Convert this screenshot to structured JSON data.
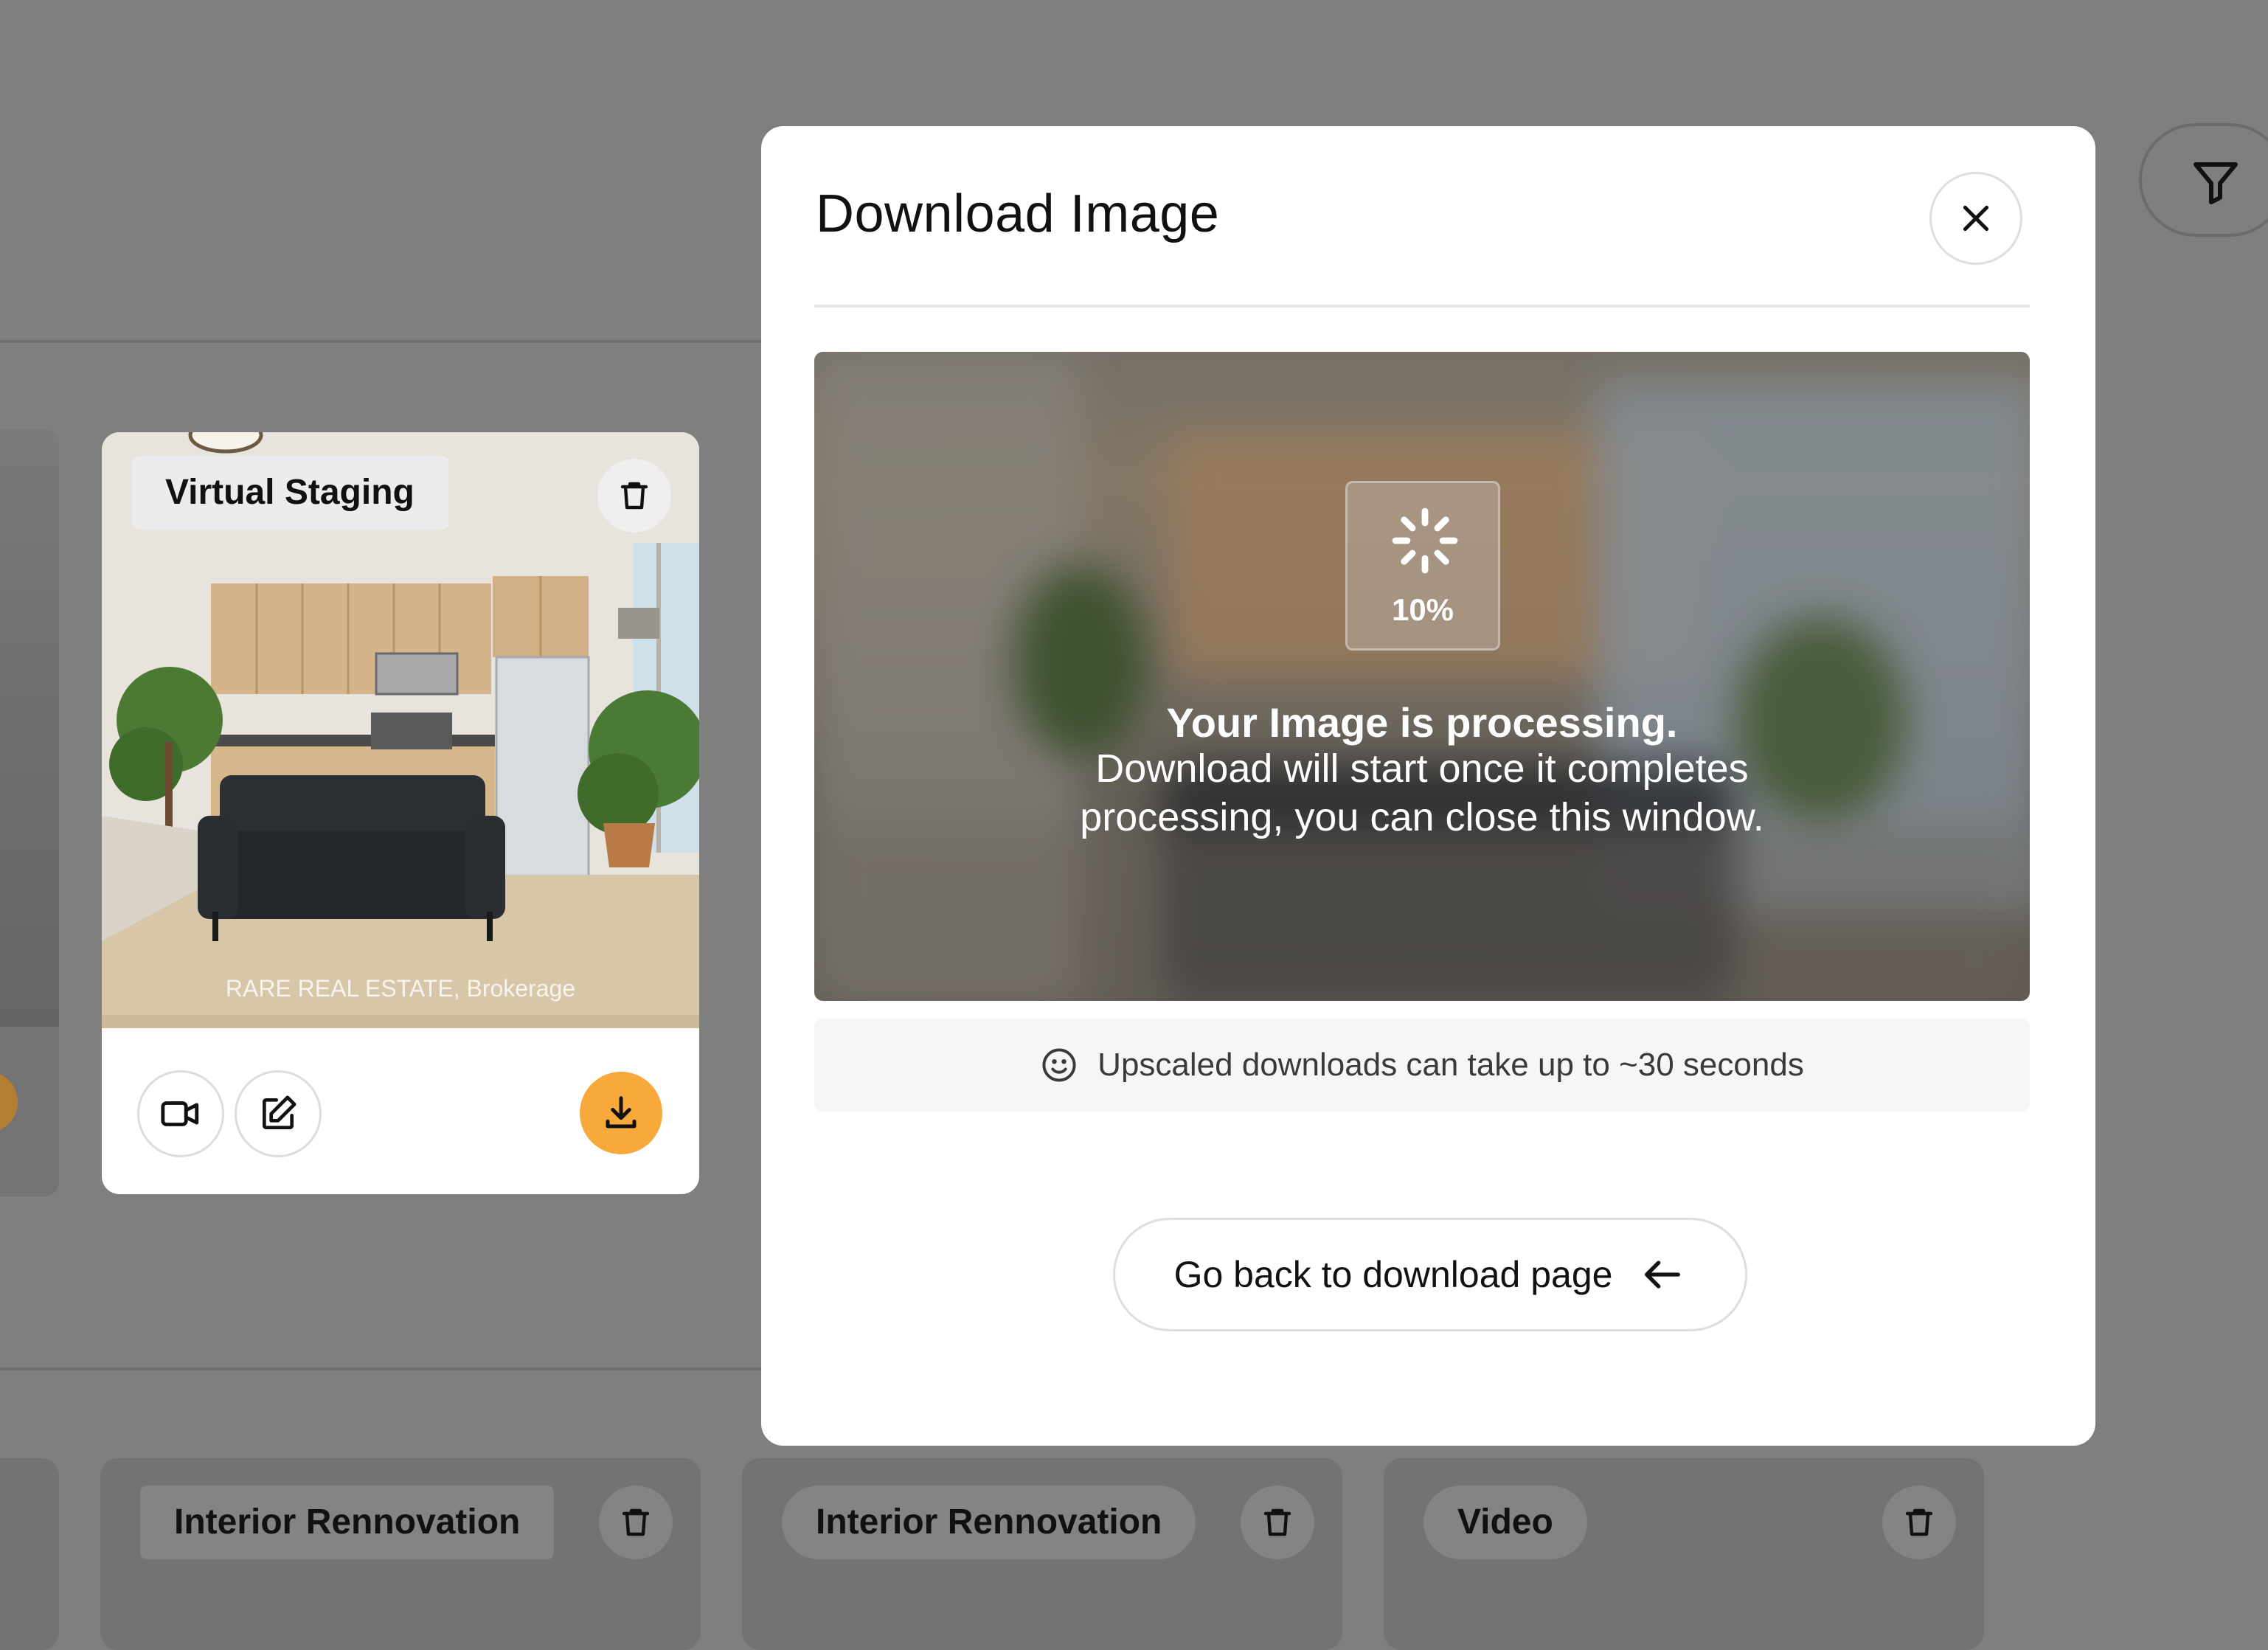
{
  "modal": {
    "title": "Download Image",
    "progress_percent": "10%",
    "processing_title": "Your Image is processing.",
    "processing_line1": "Download will start once it completes",
    "processing_line2": "processing, you can close this window.",
    "info_text": "Upscaled downloads can take up to ~30 seconds",
    "back_button_label": "Go back to download page"
  },
  "card": {
    "tag_label": "Virtual Staging",
    "watermark": "RARE REAL ESTATE, Brokerage"
  },
  "bottom_cards": [
    {
      "tag_label": "Interior Rennovation"
    },
    {
      "tag_label": "Interior Rennovation"
    },
    {
      "tag_label": "Video"
    }
  ],
  "colors": {
    "accent_orange": "#f8a93c",
    "overlay": "#7f7f7f",
    "modal_bg": "#ffffff"
  },
  "icons": [
    "filter-icon",
    "trash-icon",
    "video-camera-icon",
    "edit-icon",
    "download-icon",
    "close-icon",
    "spinner-icon",
    "smile-icon",
    "arrow-left-icon"
  ]
}
